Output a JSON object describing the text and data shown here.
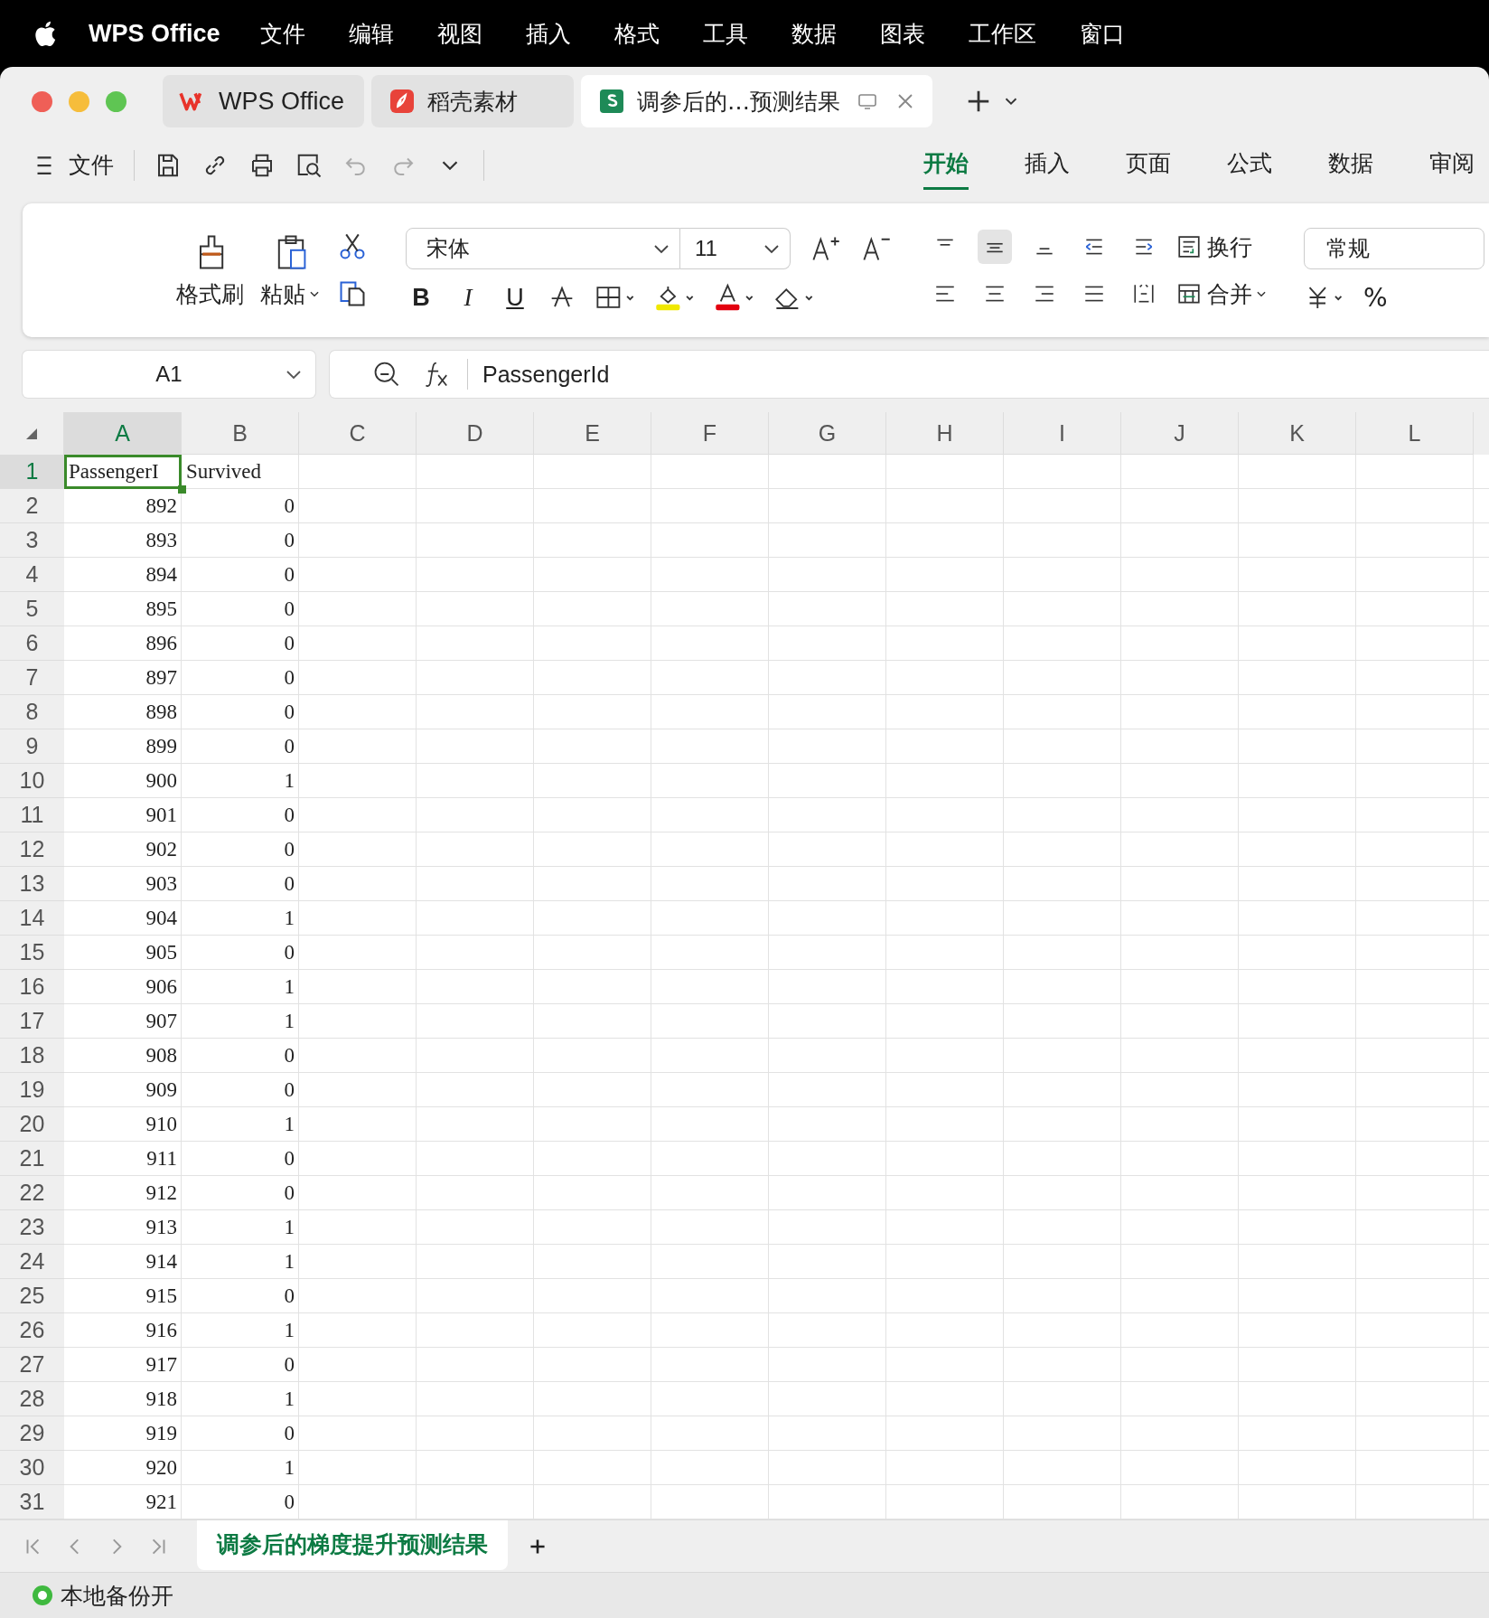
{
  "menubar": {
    "app": "WPS Office",
    "items": [
      "文件",
      "编辑",
      "视图",
      "插入",
      "格式",
      "工具",
      "数据",
      "图表",
      "工作区",
      "窗口"
    ]
  },
  "tabs": [
    {
      "label": "WPS Office",
      "kind": "home",
      "selected": false
    },
    {
      "label": "稻壳素材",
      "kind": "docer",
      "selected": false
    },
    {
      "label": "调参后的…预测结果",
      "kind": "sheet",
      "selected": true
    }
  ],
  "quick_toolbar": {
    "file_label": "文件"
  },
  "ribbon_tabs": [
    {
      "label": "开始",
      "selected": true
    },
    {
      "label": "插入",
      "selected": false
    },
    {
      "label": "页面",
      "selected": false
    },
    {
      "label": "公式",
      "selected": false
    },
    {
      "label": "数据",
      "selected": false
    },
    {
      "label": "审阅",
      "selected": false
    }
  ],
  "ribbon": {
    "format_painter": "格式刷",
    "paste": "粘贴",
    "font": "宋体",
    "font_size": "11",
    "bold": "B",
    "italic": "I",
    "underline": "U",
    "wrap": "换行",
    "merge": "合并",
    "number_format": "常规",
    "percent": "%"
  },
  "formula_bar": {
    "name_box": "A1",
    "formula": "PassengerId"
  },
  "columns": [
    {
      "label": "A",
      "selected": true
    },
    {
      "label": "B",
      "selected": false
    },
    {
      "label": "C",
      "selected": false
    },
    {
      "label": "D",
      "selected": false
    },
    {
      "label": "E",
      "selected": false
    },
    {
      "label": "F",
      "selected": false
    },
    {
      "label": "G",
      "selected": false
    },
    {
      "label": "H",
      "selected": false
    },
    {
      "label": "I",
      "selected": false
    },
    {
      "label": "J",
      "selected": false
    },
    {
      "label": "K",
      "selected": false
    },
    {
      "label": "L",
      "selected": false
    }
  ],
  "rows": [
    {
      "num": "1",
      "selected": true,
      "cells": [
        "PassengerI",
        "Survived"
      ]
    },
    {
      "num": "2",
      "selected": false,
      "cells": [
        "892",
        "0"
      ]
    },
    {
      "num": "3",
      "selected": false,
      "cells": [
        "893",
        "0"
      ]
    },
    {
      "num": "4",
      "selected": false,
      "cells": [
        "894",
        "0"
      ]
    },
    {
      "num": "5",
      "selected": false,
      "cells": [
        "895",
        "0"
      ]
    },
    {
      "num": "6",
      "selected": false,
      "cells": [
        "896",
        "0"
      ]
    },
    {
      "num": "7",
      "selected": false,
      "cells": [
        "897",
        "0"
      ]
    },
    {
      "num": "8",
      "selected": false,
      "cells": [
        "898",
        "0"
      ]
    },
    {
      "num": "9",
      "selected": false,
      "cells": [
        "899",
        "0"
      ]
    },
    {
      "num": "10",
      "selected": false,
      "cells": [
        "900",
        "1"
      ]
    },
    {
      "num": "11",
      "selected": false,
      "cells": [
        "901",
        "0"
      ]
    },
    {
      "num": "12",
      "selected": false,
      "cells": [
        "902",
        "0"
      ]
    },
    {
      "num": "13",
      "selected": false,
      "cells": [
        "903",
        "0"
      ]
    },
    {
      "num": "14",
      "selected": false,
      "cells": [
        "904",
        "1"
      ]
    },
    {
      "num": "15",
      "selected": false,
      "cells": [
        "905",
        "0"
      ]
    },
    {
      "num": "16",
      "selected": false,
      "cells": [
        "906",
        "1"
      ]
    },
    {
      "num": "17",
      "selected": false,
      "cells": [
        "907",
        "1"
      ]
    },
    {
      "num": "18",
      "selected": false,
      "cells": [
        "908",
        "0"
      ]
    },
    {
      "num": "19",
      "selected": false,
      "cells": [
        "909",
        "0"
      ]
    },
    {
      "num": "20",
      "selected": false,
      "cells": [
        "910",
        "1"
      ]
    },
    {
      "num": "21",
      "selected": false,
      "cells": [
        "911",
        "0"
      ]
    },
    {
      "num": "22",
      "selected": false,
      "cells": [
        "912",
        "0"
      ]
    },
    {
      "num": "23",
      "selected": false,
      "cells": [
        "913",
        "1"
      ]
    },
    {
      "num": "24",
      "selected": false,
      "cells": [
        "914",
        "1"
      ]
    },
    {
      "num": "25",
      "selected": false,
      "cells": [
        "915",
        "0"
      ]
    },
    {
      "num": "26",
      "selected": false,
      "cells": [
        "916",
        "1"
      ]
    },
    {
      "num": "27",
      "selected": false,
      "cells": [
        "917",
        "0"
      ]
    },
    {
      "num": "28",
      "selected": false,
      "cells": [
        "918",
        "1"
      ]
    },
    {
      "num": "29",
      "selected": false,
      "cells": [
        "919",
        "0"
      ]
    },
    {
      "num": "30",
      "selected": false,
      "cells": [
        "920",
        "1"
      ]
    },
    {
      "num": "31",
      "selected": false,
      "cells": [
        "921",
        "0"
      ]
    }
  ],
  "sheet_tabs": [
    {
      "label": "调参后的梯度提升预测结果",
      "selected": true
    }
  ],
  "status_bar": {
    "backup": "本地备份开"
  }
}
